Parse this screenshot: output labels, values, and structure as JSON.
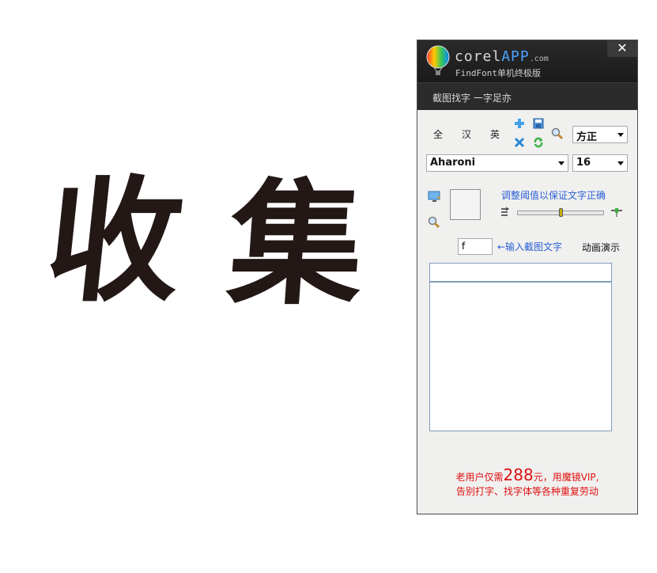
{
  "sample": {
    "char1": "收",
    "char2": "集"
  },
  "window": {
    "logo_main": "corel",
    "logo_app": "APP",
    "logo_com": ".com",
    "subtitle": "FindFont单机终极版",
    "close_label": "✕",
    "slogan": "截图找字  一字足亦"
  },
  "toolbar": {
    "lang_all": "全",
    "lang_han": "汉",
    "lang_eng": "英",
    "font_category": "方正",
    "font_name": "Aharoni",
    "font_size": "16"
  },
  "threshold": {
    "hint": "调整阈值以保证文字正确",
    "value": 0.5
  },
  "input": {
    "char_value": "f",
    "hint": "←输入截图文字",
    "demo_label": "动画演示"
  },
  "results": {
    "input_value": "",
    "items": []
  },
  "promo": {
    "line1_pre": "老用户仅需",
    "price": "288",
    "line1_post": "元，用魔镜VIP,",
    "line2": "告别打字、找字体等各种重复劳动"
  },
  "colors": {
    "accent": "#2a5fd6",
    "promo": "#e01010",
    "title_bg": "#1f1f1f"
  }
}
